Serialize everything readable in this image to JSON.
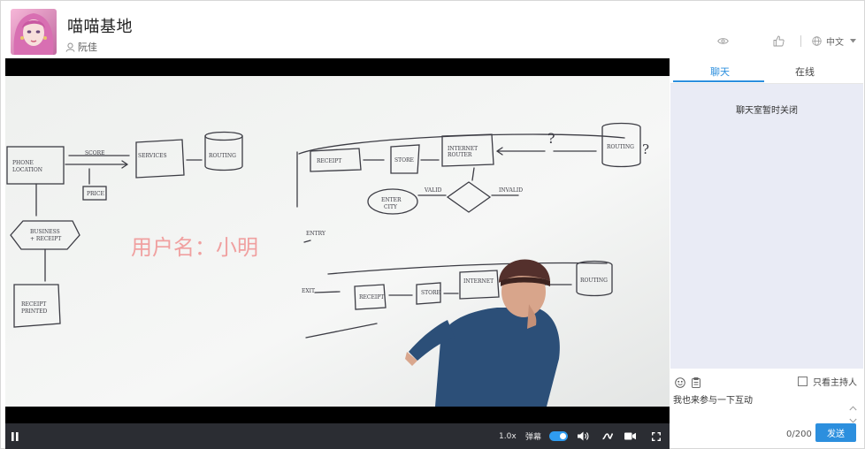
{
  "room": {
    "title": "喵喵基地",
    "host_name": "阮佳"
  },
  "header_tools": {
    "view_icon": "eye-icon",
    "like_icon": "thumbs-up-icon",
    "language": "中文",
    "language_icon": "globe-icon"
  },
  "player": {
    "watermark": "用户名：小明",
    "speed": "1.0x",
    "danmaku_label": "弹幕",
    "danmaku_on": true,
    "controls": [
      "pause-icon",
      "volume-icon",
      "line-switch-icon",
      "camera-icon",
      "fullscreen-icon"
    ]
  },
  "chat": {
    "tabs": [
      {
        "label": "聊天",
        "active": true
      },
      {
        "label": "在线",
        "active": false
      }
    ],
    "status_message": "聊天室暂时关闭",
    "host_only_label": "只看主持人",
    "input_value": "我也来参与一下互动",
    "char_count": "0/200",
    "send_label": "发送"
  },
  "colors": {
    "accent": "#2c8fde",
    "control_bar": "#2b2d33",
    "chat_bg": "#e9ebf5",
    "watermark": "#f0a0a0"
  }
}
